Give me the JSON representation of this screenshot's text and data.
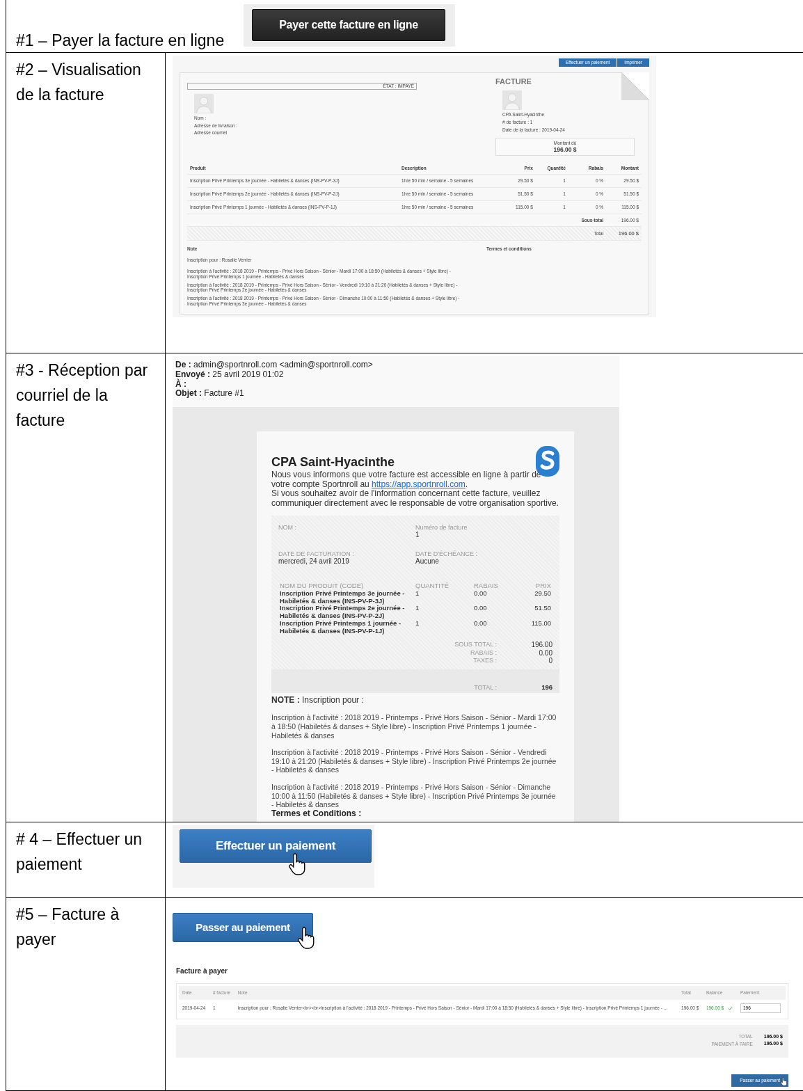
{
  "steps": [
    {
      "kind": "pay_button",
      "label": "#1 – Payer la facture en ligne",
      "button": "Payer cette facture en ligne"
    },
    {
      "kind": "invoice_view",
      "label": "#2 – Visualisation de la facture",
      "invoice": {
        "buttons": [
          "Effectuer un paiement",
          "Imprimer"
        ],
        "status": "ÉTAT : IMPAYÉ",
        "title": "FACTURE",
        "client_fields": [
          "Nom :",
          "Adresse de livraison :",
          "Adresse courriel"
        ],
        "org_fields": [
          "CPA Saint-Hyacinthe",
          "# de facture : 1",
          "Date de la facture : 2019-04-24"
        ],
        "amount_label": "Montant dû",
        "amount": "196.00 $",
        "columns": [
          "Produit",
          "Description",
          "Prix",
          "Quantité",
          "Rabais",
          "Montant"
        ],
        "rows": [
          [
            "Inscription Privé Printemps 3e journée - Habiletés & danses (INS-PV-P-3J)",
            "1hre 50 min / semaine - 5 semaines",
            "29.50 $",
            "1",
            "0 %",
            "29.50 $"
          ],
          [
            "Inscription Privé Printemps 2e journée - Habiletés & danses (INS-PV-P-2J)",
            "1hre 50 min / semaine - 5 semaines",
            "51.50 $",
            "1",
            "0 %",
            "51.50 $"
          ],
          [
            "Inscription Privé Printemps 1 journée - Habiletés & danses (INS-PV-P-1J)",
            "1hre 50 min / semaine - 5 semaines",
            "115.00 $",
            "1",
            "0 %",
            "115.00 $"
          ]
        ],
        "subtotal_label": "Sous-total",
        "subtotal": "196.00 $",
        "total_label": "Total",
        "total": "196.00 $",
        "note_label": "Note",
        "note_lines": [
          "Inscription pour : Rosalie Verrier",
          "Inscription à l'activité : 2018 2019 - Printemps - Privé Hors Saison - Sénior - Mardi 17:00 à 18:50 (Habiletés & danses + Style libre) - Inscription Privé Printemps 1 journée - Habiletés & danses",
          "Inscription à l'activité : 2018 2019 - Printemps - Privé Hors Saison - Sénior - Vendredi 19:10 à 21:20 (Habiletés & danses + Style libre) - Inscription Privé Printemps 2e journée - Habiletés & danses",
          "Inscription à l'activité : 2018 2019 - Printemps - Privé Hors Saison - Sénior - Dimanche 10:00 à 11:50 (Habiletés & danses + Style libre) - Inscription Privé Printemps 3e journée - Habiletés & danses"
        ],
        "terms_label": "Termes et conditions"
      }
    },
    {
      "kind": "email",
      "label": "#3 - Réception par courriel de la facture",
      "email": {
        "headers": [
          "**De :** admin@sportnroll.com <admin@sportnroll.com>",
          "**Envoyé :** 25 avril 2019 01:02",
          "**À :**",
          "**Objet :** Facture #1"
        ],
        "org": "CPA Saint-Hyacinthe",
        "intro": "Nous vous informons que votre facture est accessible en ligne à partir de votre compte Sportnroll au ",
        "link": "https://app.sportnroll.com",
        "intro_end": ".",
        "contact": "Si vous souhaitez avoir de l'information concernant cette facture, veuillez communiquer directement avec le responsable de votre organisation sportive.",
        "fields": [
          {
            "label": "NOM :"
          },
          {
            "label": "Numéro de facture",
            "value": "1"
          },
          {
            "label": "DATE DE FACTURATION :",
            "value": "mercredi, 24 avril 2019"
          },
          {
            "label": "DATE D'ÉCHÉANCE :",
            "value": "Aucune"
          }
        ],
        "columns": [
          "NOM DU PRODUIT (CODE)",
          "QUANTITÉ",
          "RABAIS",
          "PRIX"
        ],
        "items": [
          [
            "Inscription Privé Printemps 3e journée - Habiletés & danses (INS-PV-P-3J)",
            "1",
            "0.00",
            "29.50"
          ],
          [
            "Inscription Privé Printemps 2e journée - Habiletés & danses (INS-PV-P-2J)",
            "1",
            "0.00",
            "51.50"
          ],
          [
            "Inscription Privé Printemps 1 journée - Habiletés & danses (INS-PV-P-1J)",
            "1",
            "0.00",
            "115.00"
          ]
        ],
        "totals": [
          {
            "label": "SOUS TOTAL :",
            "value": "196.00"
          },
          {
            "label": "RABAIS :",
            "value": "0.00"
          },
          {
            "label": "TAXES :",
            "value": "0"
          }
        ],
        "total_label": "TOTAL :",
        "total": "196",
        "note": "**NOTE :** Inscription pour :",
        "note_lines": [
          "Inscription à l'activité : 2018 2019 - Printemps - Privé Hors Saison - Sénior - Mardi 17:00 à 18:50 (Habiletés & danses + Style libre) - Inscription Privé Printemps 1 journée - Habiletés & danses",
          "Inscription à l'activité : 2018 2019 - Printemps - Privé Hors Saison - Sénior - Vendredi 19:10 à 21:20 (Habiletés & danses + Style libre) - Inscription Privé Printemps 2e journée - Habiletés & danses",
          "Inscription à l'activité : 2018 2019 - Printemps - Privé Hors Saison - Sénior - Dimanche 10:00 à 11:50 (Habiletés & danses + Style libre) - Inscription Privé Printemps 3e journée - Habiletés & danses"
        ],
        "terms": "Termes et Conditions :"
      }
    },
    {
      "kind": "payment_button",
      "label": "# 4 – Effectuer un paiement",
      "button": "Effectuer un paiement"
    },
    {
      "kind": "invoice_payable",
      "label": "#5 – Facture à payer",
      "button": "Passer au paiement",
      "heading": "Facture à payer",
      "columns": [
        "Date",
        "# facture",
        "Note",
        "Total",
        "Balance",
        "Paiement"
      ],
      "row": {
        "date": "2019-04-24",
        "number": "1",
        "note": "Inscription pour : Rosalie Verrier<br><br>Inscription à l'activité : 2018 2019 - Printemps - Privé Hors Saison - Sénior - Mardi 17:00 à 18:50 (Habiletés & danses + Style libre) - Inscription Privé Printemps 1 journée - ...",
        "total": "196.00 $",
        "balance": "196.00 $",
        "payment": "196"
      },
      "totals": [
        {
          "label": "TOTAL",
          "value": "196.00 $"
        },
        {
          "label": "PAIEMENT À FAIRE",
          "value": "196.00 $"
        }
      ],
      "submit": "Passer au paiement"
    }
  ]
}
